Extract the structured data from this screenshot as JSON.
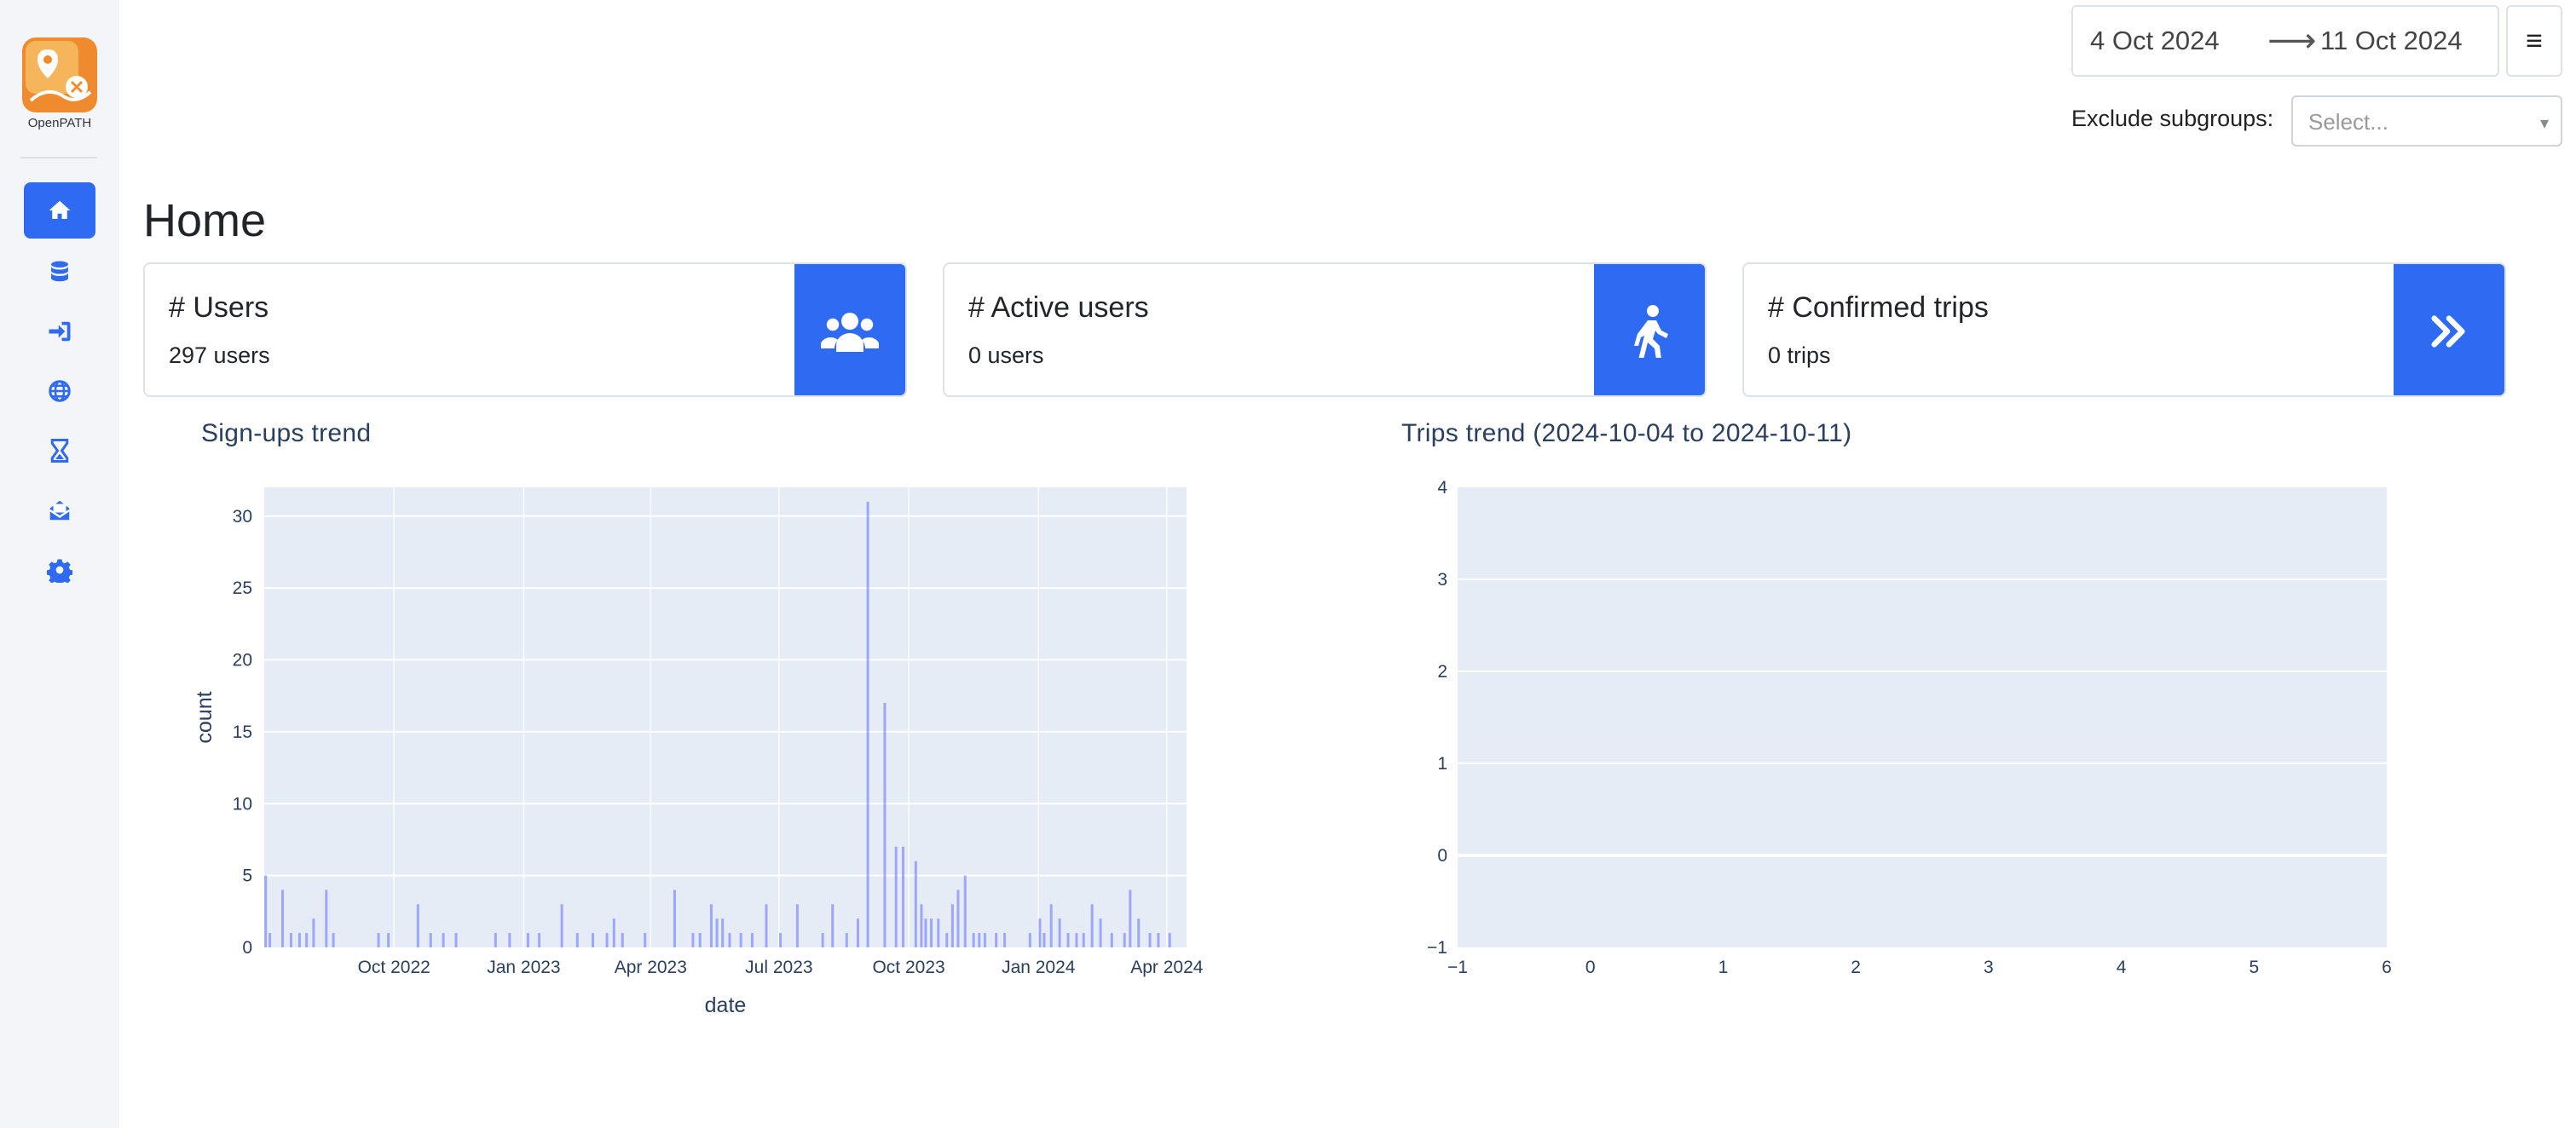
{
  "app": {
    "logo_text": "OpenPATH"
  },
  "sidebar": {
    "items": [
      {
        "name": "home",
        "icon": "home-icon",
        "active": true
      },
      {
        "name": "data",
        "icon": "database-icon",
        "active": false
      },
      {
        "name": "tokens",
        "icon": "sign-in-icon",
        "active": false
      },
      {
        "name": "map",
        "icon": "globe-icon",
        "active": false
      },
      {
        "name": "segment-trip-time",
        "icon": "hourglass-icon",
        "active": false
      },
      {
        "name": "push-notification",
        "icon": "envelope-open-icon",
        "active": false
      },
      {
        "name": "settings",
        "icon": "gear-icon",
        "active": false
      }
    ]
  },
  "header": {
    "date_start": "4 Oct 2024",
    "date_arrow": "⟶",
    "date_end": "11 Oct 2024",
    "menu_icon": "≡",
    "exclude_label": "Exclude subgroups:",
    "exclude_placeholder": "Select...",
    "exclude_caret": "▾"
  },
  "page": {
    "title": "Home"
  },
  "cards": [
    {
      "title": "# Users",
      "value": "297 users",
      "icon": "users-icon"
    },
    {
      "title": "# Active users",
      "value": "0 users",
      "icon": "walking-icon"
    },
    {
      "title": "# Confirmed trips",
      "value": "0 trips",
      "icon": "double-chevron-right-icon"
    }
  ],
  "colors": {
    "accent": "#2e6af2",
    "plot_bg": "#e5ecf6",
    "bar": "#636efa"
  },
  "chart_data": [
    {
      "type": "bar",
      "title": "Sign-ups trend",
      "xlabel": "date",
      "ylabel": "count",
      "ylim": [
        0,
        32
      ],
      "xlim": [
        "2022-07-01",
        "2024-04-15"
      ],
      "yticks": [
        0,
        5,
        10,
        15,
        20,
        25,
        30
      ],
      "xticks": [
        {
          "label": "Oct 2022",
          "date": "2022-10-01"
        },
        {
          "label": "Jan 2023",
          "date": "2023-01-01"
        },
        {
          "label": "Apr 2023",
          "date": "2023-04-01"
        },
        {
          "label": "Jul 2023",
          "date": "2023-07-01"
        },
        {
          "label": "Oct 2023",
          "date": "2023-10-01"
        },
        {
          "label": "Jan 2024",
          "date": "2024-01-01"
        },
        {
          "label": "Apr 2024",
          "date": "2024-04-01"
        }
      ],
      "x": [
        "2022-07-02",
        "2022-07-05",
        "2022-07-14",
        "2022-07-20",
        "2022-07-26",
        "2022-07-31",
        "2022-08-05",
        "2022-08-14",
        "2022-08-19",
        "2022-09-20",
        "2022-09-27",
        "2022-10-18",
        "2022-10-27",
        "2022-11-05",
        "2022-11-14",
        "2022-12-12",
        "2022-12-22",
        "2023-01-04",
        "2023-01-12",
        "2023-01-28",
        "2023-02-08",
        "2023-02-19",
        "2023-03-01",
        "2023-03-06",
        "2023-03-12",
        "2023-03-28",
        "2023-04-18",
        "2023-05-01",
        "2023-05-06",
        "2023-05-14",
        "2023-05-18",
        "2023-05-22",
        "2023-05-27",
        "2023-06-04",
        "2023-06-12",
        "2023-06-22",
        "2023-07-02",
        "2023-07-14",
        "2023-08-01",
        "2023-08-08",
        "2023-08-18",
        "2023-08-26",
        "2023-09-02",
        "2023-09-14",
        "2023-09-22",
        "2023-09-27",
        "2023-10-06",
        "2023-10-10",
        "2023-10-13",
        "2023-10-17",
        "2023-10-22",
        "2023-10-28",
        "2023-11-01",
        "2023-11-05",
        "2023-11-10",
        "2023-11-16",
        "2023-11-20",
        "2023-11-24",
        "2023-12-02",
        "2023-12-08",
        "2023-12-26",
        "2024-01-02",
        "2024-01-05",
        "2024-01-10",
        "2024-01-16",
        "2024-01-22",
        "2024-01-28",
        "2024-02-02",
        "2024-02-08",
        "2024-02-14",
        "2024-02-22",
        "2024-03-02",
        "2024-03-06",
        "2024-03-12",
        "2024-03-20",
        "2024-03-26",
        "2024-04-03"
      ],
      "values": [
        5,
        1,
        4,
        1,
        1,
        1,
        2,
        4,
        1,
        1,
        1,
        3,
        1,
        1,
        1,
        1,
        1,
        1,
        1,
        3,
        1,
        1,
        1,
        2,
        1,
        1,
        4,
        1,
        1,
        3,
        2,
        2,
        1,
        1,
        1,
        3,
        1,
        3,
        1,
        3,
        1,
        2,
        31,
        17,
        7,
        7,
        6,
        3,
        2,
        2,
        2,
        1,
        3,
        4,
        5,
        1,
        1,
        1,
        1,
        1,
        1,
        2,
        1,
        3,
        2,
        1,
        1,
        1,
        3,
        2,
        1,
        1,
        4,
        2,
        1,
        1,
        1
      ]
    },
    {
      "type": "line",
      "title": "Trips trend (2024-10-04 to 2024-10-11)",
      "xlabel": "",
      "ylabel": "",
      "xlim": [
        -1,
        6
      ],
      "ylim": [
        -1,
        4
      ],
      "xticks": [
        -1,
        0,
        1,
        2,
        3,
        4,
        5,
        6
      ],
      "yticks": [
        -1,
        0,
        1,
        2,
        3,
        4
      ],
      "series": []
    }
  ]
}
